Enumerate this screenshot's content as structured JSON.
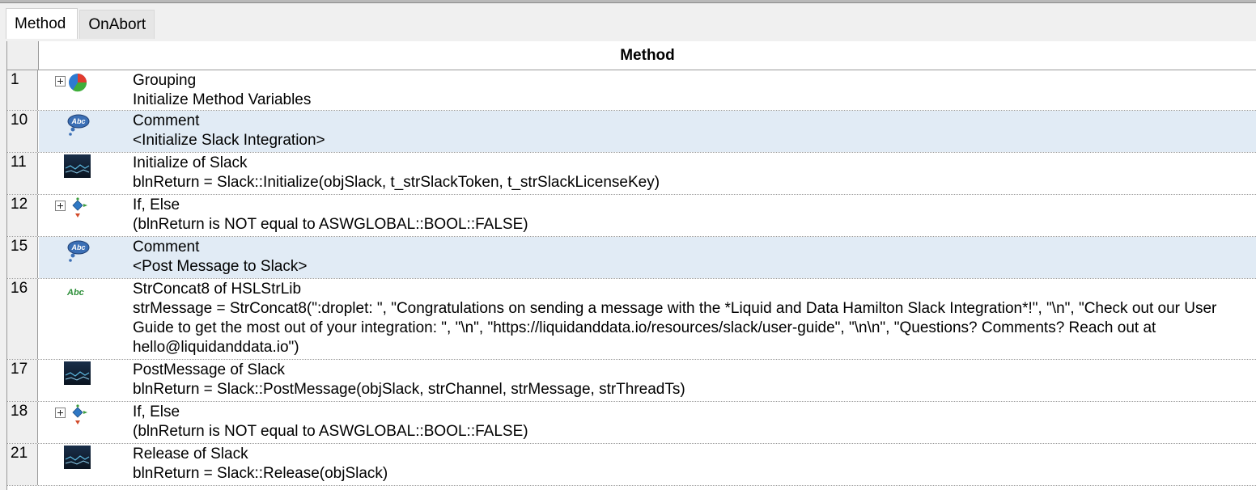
{
  "tabs": {
    "method": "Method",
    "onabort": "OnAbort"
  },
  "grid": {
    "header": "Method"
  },
  "rows": [
    {
      "num": "1",
      "title": "Grouping",
      "detail": "Initialize Method Variables",
      "icon": "grouping-icon",
      "expandable": true
    },
    {
      "num": "10",
      "title": "Comment",
      "detail": "<Initialize Slack Integration>",
      "icon": "comment-icon",
      "highlighted": true
    },
    {
      "num": "11",
      "title": "Initialize of Slack",
      "detail": "blnReturn = Slack::Initialize(objSlack, t_strSlackToken, t_strSlackLicenseKey)",
      "icon": "slack-library-icon"
    },
    {
      "num": "12",
      "title": "If, Else",
      "detail": "(blnReturn is NOT equal to ASWGLOBAL::BOOL::FALSE)",
      "icon": "if-else-icon",
      "expandable": true
    },
    {
      "num": "15",
      "title": "Comment",
      "detail": "<Post Message to Slack>",
      "icon": "comment-icon",
      "highlighted": true
    },
    {
      "num": "16",
      "title": "StrConcat8 of HSLStrLib",
      "detail": "strMessage = StrConcat8(\":droplet: \", \"Congratulations on sending a message with the *Liquid and Data Hamilton Slack Integration*!\", \"\\n\", \"Check out our User Guide to get the most out of your integration: \", \"\\n\", \"https://liquidanddata.io/resources/slack/user-guide\", \"\\n\\n\", \"Questions? Comments? Reach out at hello@liquidanddata.io\")",
      "icon": "string-library-icon"
    },
    {
      "num": "17",
      "title": "PostMessage of Slack",
      "detail": "blnReturn = Slack::PostMessage(objSlack, strChannel, strMessage, strThreadTs)",
      "icon": "slack-library-icon"
    },
    {
      "num": "18",
      "title": "If, Else",
      "detail": "(blnReturn is NOT equal to ASWGLOBAL::BOOL::FALSE)",
      "icon": "if-else-icon",
      "expandable": true
    },
    {
      "num": "21",
      "title": "Release of Slack",
      "detail": "blnReturn = Slack::Release(objSlack)",
      "icon": "slack-library-icon"
    }
  ],
  "icon_labels": {
    "comment": "Abc",
    "string": "Abc"
  },
  "colors": {
    "highlight": "#e1ebf5",
    "rownum_bg": "#efefef"
  }
}
